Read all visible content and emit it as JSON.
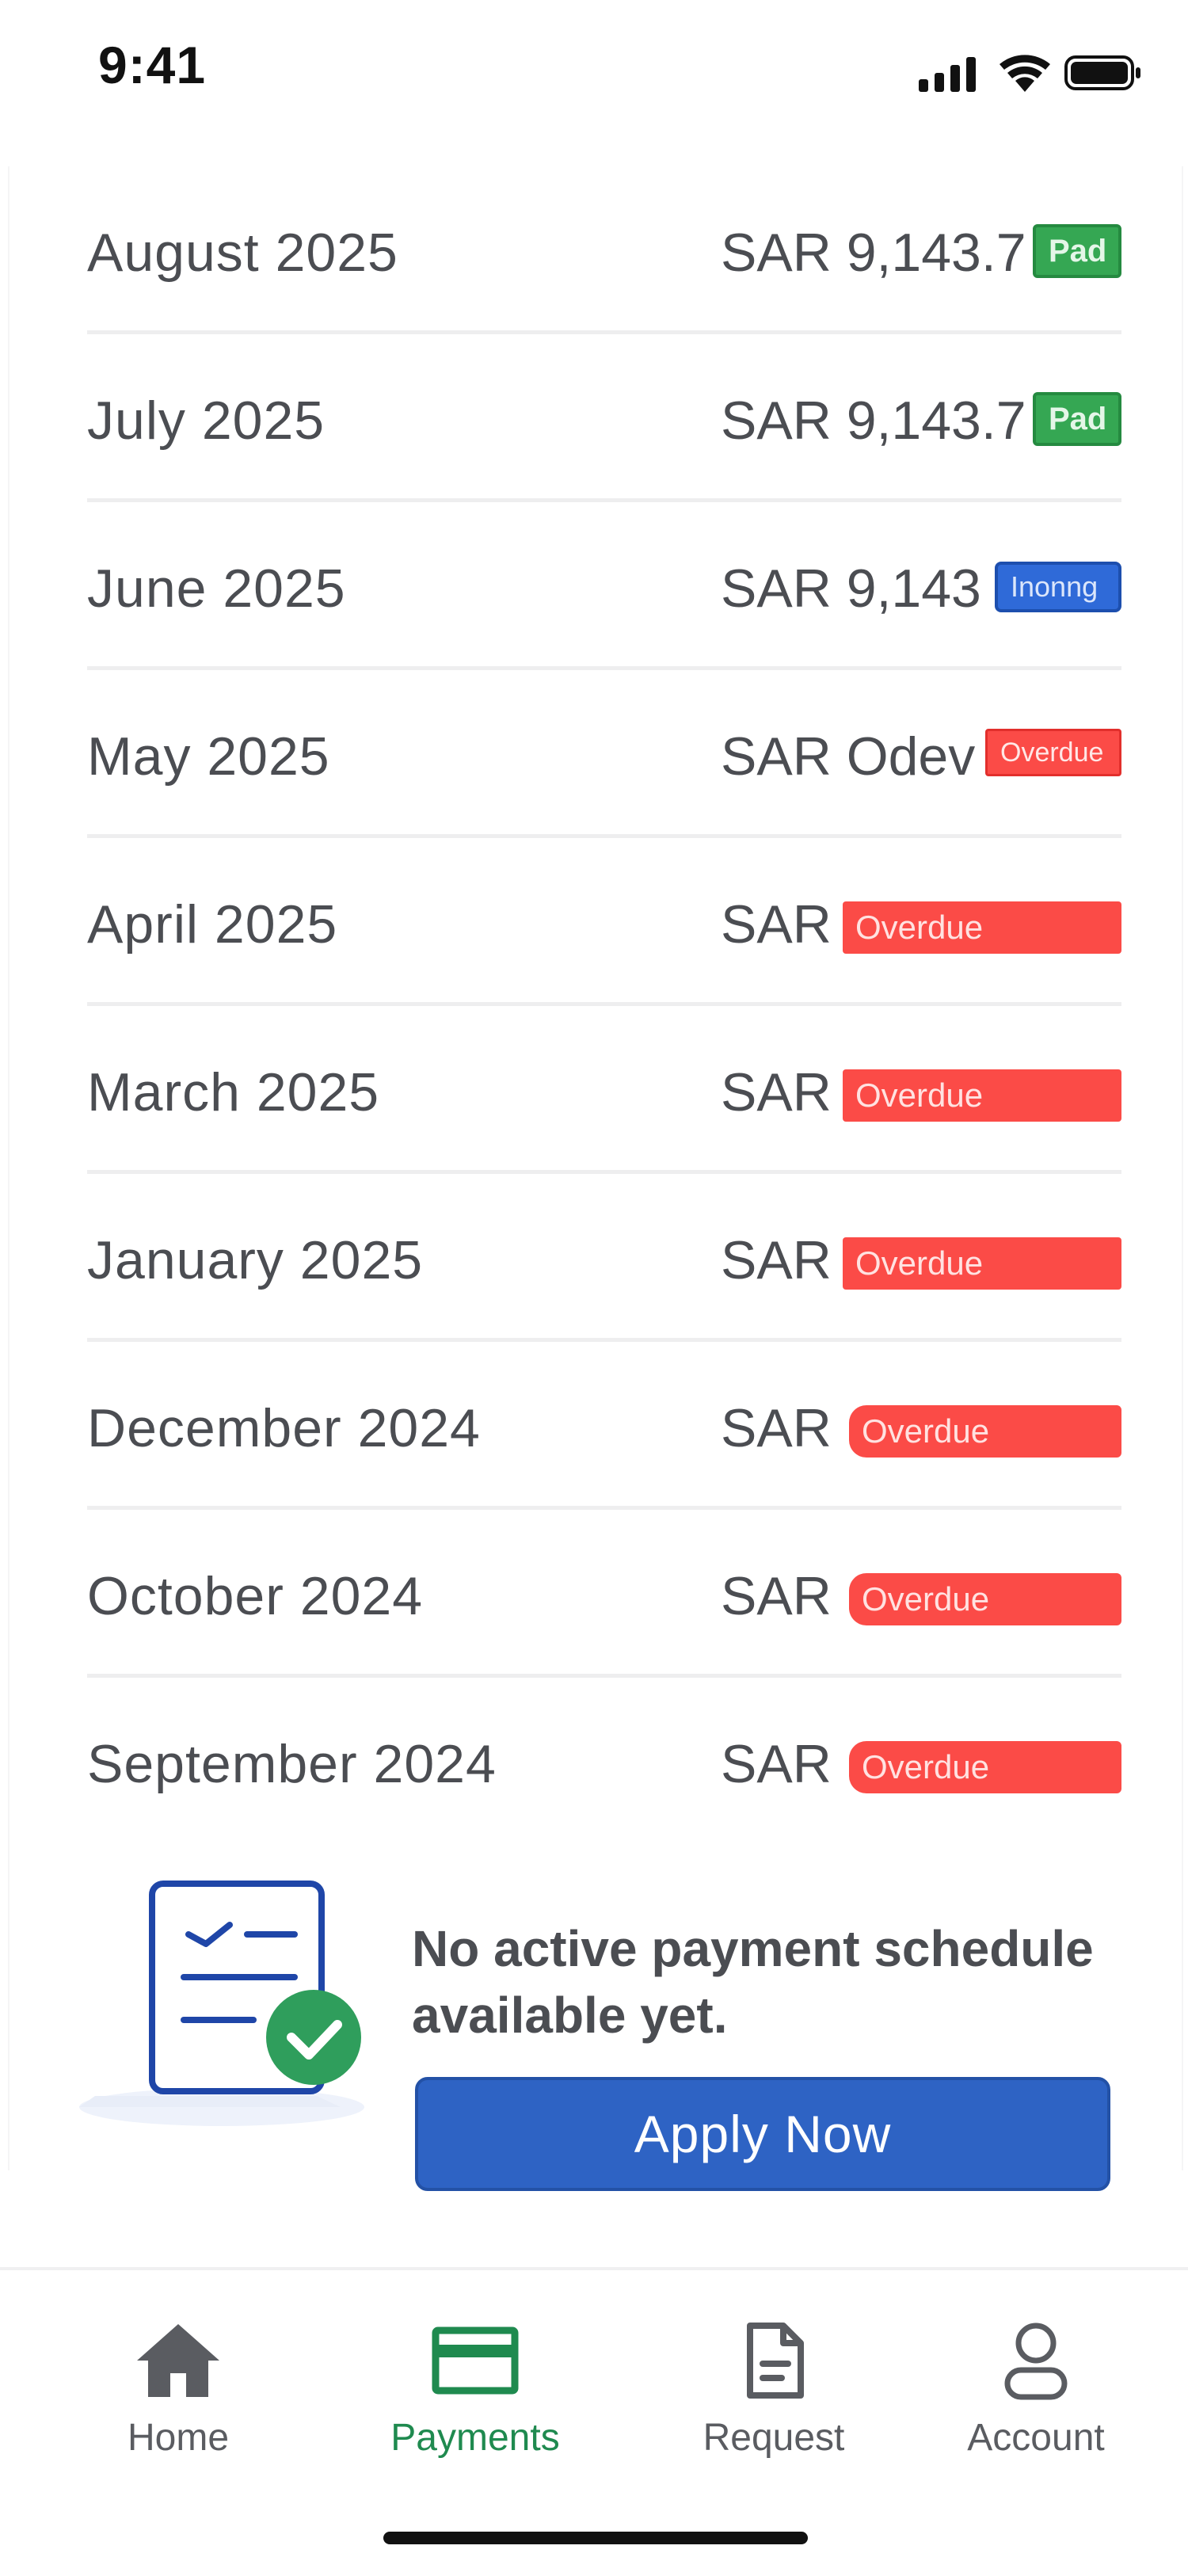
{
  "status_bar": {
    "time": "9:41"
  },
  "payments": [
    {
      "month": "August 2025",
      "amount": "SAR 9,143.7",
      "status": "Pad",
      "status_type": "paid"
    },
    {
      "month": "July 2025",
      "amount": "SAR 9,143.7",
      "status": "Pad",
      "status_type": "paid"
    },
    {
      "month": "June 2025",
      "amount": "SAR 9,143",
      "status": "Inonng",
      "status_type": "ongoing"
    },
    {
      "month": "May 2025",
      "amount": "SAR Odev",
      "status": "Overdue",
      "status_type": "overdue"
    },
    {
      "month": "April 2025",
      "amount": "SAR",
      "status": "Overdue",
      "status_type": "overdue"
    },
    {
      "month": "March 2025",
      "amount": "SAR",
      "status": "Overdue",
      "status_type": "overdue"
    },
    {
      "month": "January 2025",
      "amount": "SAR",
      "status": "Overdue",
      "status_type": "overdue"
    },
    {
      "month": "December 2024",
      "amount": "SAR",
      "status": "Overdue",
      "status_type": "overdue"
    },
    {
      "month": "October 2024",
      "amount": "SAR",
      "status": "Overdue",
      "status_type": "overdue"
    },
    {
      "month": "September 2024",
      "amount": "SAR",
      "status": "Overdue",
      "status_type": "overdue"
    }
  ],
  "empty_state": {
    "message": "No active payment schedule available yet.",
    "button_label": "Apply Now",
    "icon": "document-check-icon"
  },
  "tabs": [
    {
      "label": "Home",
      "icon": "home-icon",
      "active": false
    },
    {
      "label": "Payments",
      "icon": "credit-card-icon",
      "active": true
    },
    {
      "label": "Request",
      "icon": "document-icon",
      "active": false
    },
    {
      "label": "Account",
      "icon": "user-icon",
      "active": false
    }
  ],
  "colors": {
    "paid": "#35a753",
    "ongoing": "#2f6ad8",
    "overdue": "#fb4b47",
    "primary_button": "#2e63c4",
    "active_tab": "#1f8a4f"
  }
}
